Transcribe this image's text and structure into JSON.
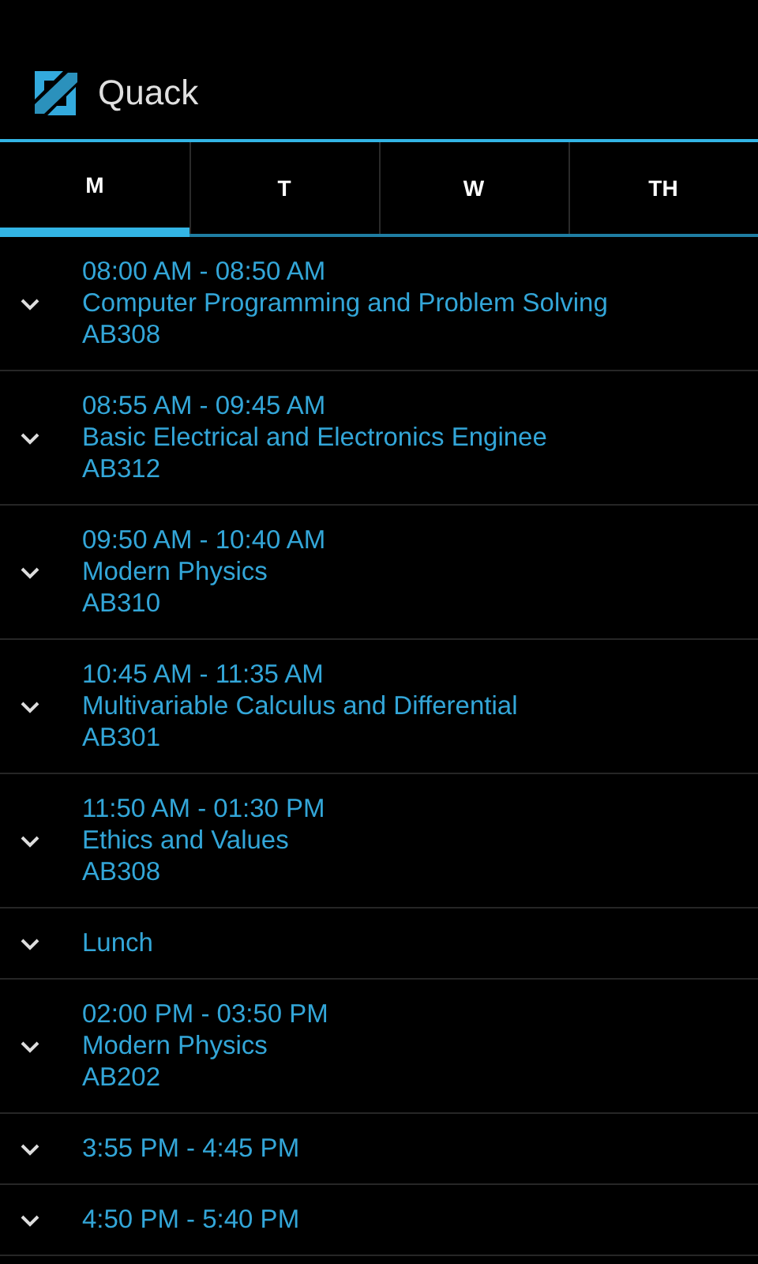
{
  "app_bar": {
    "title": "Quack"
  },
  "tabs": [
    {
      "label": "M",
      "selected": true
    },
    {
      "label": "T",
      "selected": false
    },
    {
      "label": "W",
      "selected": false
    },
    {
      "label": "TH",
      "selected": false
    }
  ],
  "rows": [
    {
      "lines": [
        "08:00 AM - 08:50 AM",
        "Computer Programming and Problem Solving",
        "AB308"
      ],
      "expanded": false
    },
    {
      "lines": [
        "08:55 AM - 09:45 AM",
        "Basic Electrical and Electronics Enginee",
        "AB312"
      ],
      "expanded": false
    },
    {
      "lines": [
        "09:50 AM - 10:40 AM",
        "Modern Physics",
        "AB310"
      ],
      "expanded": false
    },
    {
      "lines": [
        "10:45 AM - 11:35 AM",
        "Multivariable Calculus and Differential",
        "AB301"
      ],
      "expanded": false
    },
    {
      "lines": [
        "11:50 AM - 01:30 PM",
        "Ethics and Values",
        "AB308"
      ],
      "expanded": false
    },
    {
      "lines": [
        "Lunch"
      ],
      "expanded": false
    },
    {
      "lines": [
        "02:00 PM - 03:50 PM",
        "Modern Physics",
        "AB202"
      ],
      "expanded": false
    },
    {
      "lines": [
        "3:55 PM - 4:45 PM"
      ],
      "expanded": false
    },
    {
      "lines": [
        "4:50 PM - 5:40 PM"
      ],
      "expanded": false
    }
  ]
}
